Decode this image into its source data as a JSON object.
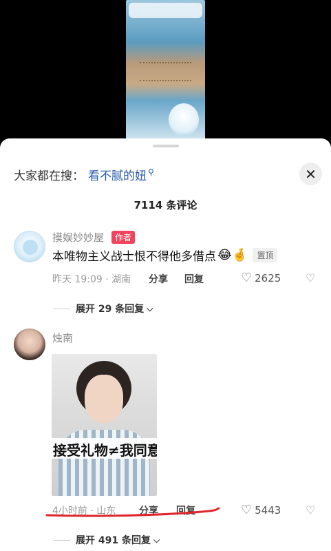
{
  "search": {
    "prefix": "大家都在搜：",
    "term": "看不腻的妞"
  },
  "comment_count": "7114 条评论",
  "comments": [
    {
      "username": "摸娱妙妙屋",
      "badge": "作者",
      "text": "本唯物主义战士恨不得他多借点",
      "emojis": "😂🤞",
      "pinned": "置顶",
      "time_location": "昨天 19:09 · 湖南",
      "share": "分享",
      "reply": "回复",
      "likes": "2625",
      "expand": "展开 29 条回复"
    },
    {
      "username": "烛南",
      "image_caption": "接受礼物≠我同意",
      "time_location": "4小时前 · 山东",
      "share": "分享",
      "reply": "回复",
      "likes": "5443",
      "expand": "展开 491 条回复"
    }
  ],
  "icons": {
    "search": "search-icon",
    "close": "close-icon",
    "like": "heart-icon",
    "dislike": "broken-heart-icon",
    "expand": "chevron-down-icon"
  },
  "colors": {
    "accent_link": "#2a5caa",
    "author_badge": "#f0435e",
    "underline": "#e0262b"
  }
}
